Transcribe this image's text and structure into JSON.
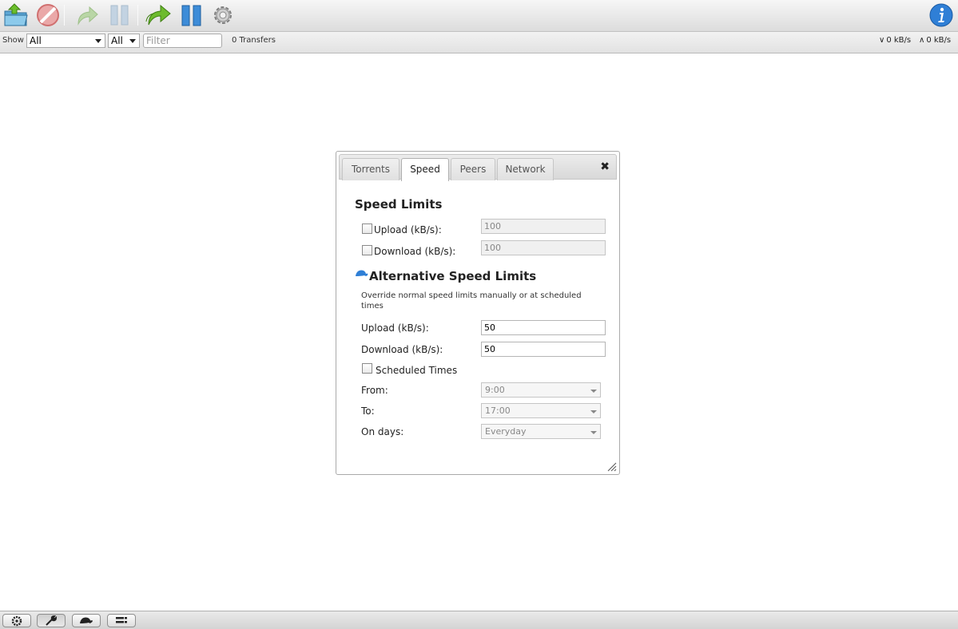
{
  "toolbar": {
    "icons": [
      "open-torrent-icon",
      "remove-torrent-icon",
      "start-icon",
      "pause-icon",
      "start-all-icon",
      "pause-all-icon",
      "preferences-icon",
      "about-icon"
    ]
  },
  "filterbar": {
    "show_label": "Show",
    "filter_state": "All",
    "filter_tracker": "All",
    "filter_placeholder": "Filter",
    "transfers": "0 Transfers",
    "download_speed": "0 kB/s",
    "upload_speed": "0 kB/s"
  },
  "dialog": {
    "tabs": [
      {
        "label": "Torrents",
        "active": false
      },
      {
        "label": "Speed",
        "active": true
      },
      {
        "label": "Peers",
        "active": false
      },
      {
        "label": "Network",
        "active": false
      }
    ],
    "close_symbol": "✖",
    "speed_limits": {
      "title": "Speed Limits",
      "upload_label": "Upload (kB/s):",
      "upload_value": "100",
      "download_label": "Download (kB/s):",
      "download_value": "100"
    },
    "alt_speed": {
      "title": "Alternative Speed Limits",
      "description": "Override normal speed limits manually or at scheduled times",
      "upload_label": "Upload (kB/s):",
      "upload_value": "50",
      "download_label": "Download (kB/s):",
      "download_value": "50",
      "scheduled_label": "Scheduled Times",
      "from_label": "From:",
      "from_value": "9:00",
      "to_label": "To:",
      "to_value": "17:00",
      "days_label": "On days:",
      "days_value": "Everyday"
    }
  },
  "colors": {
    "accent_blue": "#2f7fd6",
    "green": "#5aa826"
  }
}
